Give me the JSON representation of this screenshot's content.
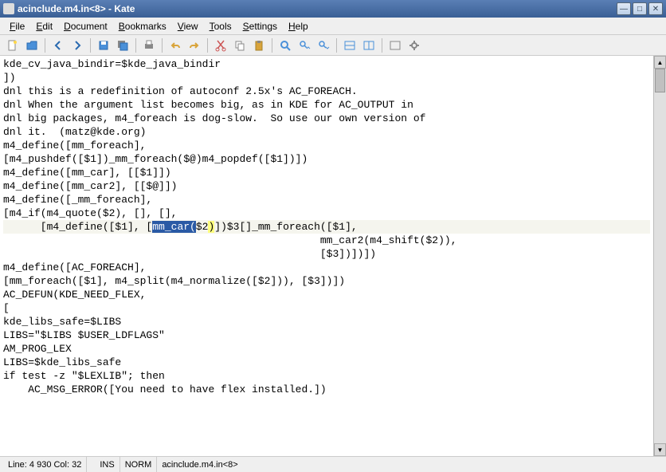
{
  "window": {
    "title": "acinclude.m4.in<8> - Kate"
  },
  "menu": {
    "file": "File",
    "edit": "Edit",
    "document": "Document",
    "bookmarks": "Bookmarks",
    "view": "View",
    "tools": "Tools",
    "settings": "Settings",
    "help": "Help"
  },
  "icons": {
    "new": "new-file-icon",
    "open": "open-icon",
    "back": "back-icon",
    "forward": "forward-icon",
    "save": "save-icon",
    "saveall": "save-all-icon",
    "print": "print-icon",
    "undo": "undo-icon",
    "redo": "redo-icon",
    "cut": "cut-icon",
    "copy": "copy-icon",
    "paste": "paste-icon",
    "find": "find-icon",
    "findnext": "find-next-icon",
    "findprev": "find-prev-icon",
    "split-h": "split-horizontal-icon",
    "split-v": "split-vertical-icon",
    "close-view": "close-view-icon",
    "config": "configure-icon"
  },
  "editor": {
    "lines": [
      "kde_cv_java_bindir=$kde_java_bindir",
      "])",
      "",
      "dnl this is a redefinition of autoconf 2.5x's AC_FOREACH.",
      "dnl When the argument list becomes big, as in KDE for AC_OUTPUT in",
      "dnl big packages, m4_foreach is dog-slow.  So use our own version of",
      "dnl it.  (matz@kde.org)",
      "m4_define([mm_foreach],",
      "[m4_pushdef([$1])_mm_foreach($@)m4_popdef([$1])])",
      "m4_define([mm_car], [[$1]])",
      "m4_define([mm_car2], [[$@]])",
      "m4_define([_mm_foreach],",
      "[m4_if(m4_quote($2), [], [],",
      "      [m4_define([$1], [mm_car($2)])$3[]_mm_foreach([$1],",
      "                                                   mm_car2(m4_shift($2)),",
      "                                                   [$3])])])",
      "m4_define([AC_FOREACH],",
      "[mm_foreach([$1], m4_split(m4_normalize([$2])), [$3])])",
      "",
      "AC_DEFUN(KDE_NEED_FLEX,",
      "[",
      "kde_libs_safe=$LIBS",
      "LIBS=\"$LIBS $USER_LDFLAGS\"",
      "AM_PROG_LEX",
      "LIBS=$kde_libs_safe",
      "if test -z \"$LEXLIB\"; then",
      "    AC_MSG_ERROR([You need to have flex installed.])"
    ],
    "highlight_line_index": 13,
    "selection": {
      "text": "mm_car(",
      "prefix": "      [m4_define([$1], ["
    },
    "bracket_highlight": {
      "char": ")",
      "before": "$2"
    }
  },
  "status": {
    "position": "Line: 4 930 Col: 32",
    "insert": "INS",
    "mode": "NORM",
    "file": "acinclude.m4.in<8>"
  }
}
